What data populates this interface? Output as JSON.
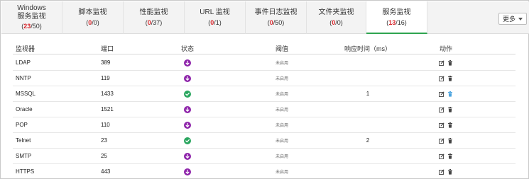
{
  "colors": {
    "tab_count_red": "#d9262b",
    "active_tab_underline": "#2ea44f",
    "status_down": "#8e24aa",
    "status_up": "#2aa65f",
    "delete_hover": "#4aa3df"
  },
  "tabs": [
    {
      "label_line1": "Windows",
      "label_line2": "服务监视",
      "count_prefix": "(",
      "count_bad": "23",
      "count_total": "/50)"
    },
    {
      "label": "脚本监视",
      "count_prefix": "(",
      "count_bad": "0",
      "count_total": "/0)"
    },
    {
      "label": "性能监视",
      "count_prefix": "(",
      "count_bad": "0",
      "count_total": "/37)"
    },
    {
      "label": "URL 监视",
      "count_prefix": "(",
      "count_bad": "0",
      "count_total": "/1)"
    },
    {
      "label": "事件日志监视",
      "count_prefix": "(",
      "count_bad": "0",
      "count_total": "/50)"
    },
    {
      "label": "文件夹监视",
      "count_prefix": "(",
      "count_bad": "0",
      "count_total": "/0)"
    },
    {
      "label": "服务监视",
      "count_prefix": "(",
      "count_bad": "13",
      "count_total": "/16)"
    }
  ],
  "more_button": {
    "label": "更多"
  },
  "table": {
    "headers": {
      "monitor": "监视器",
      "port": "端口",
      "status": "状态",
      "threshold": "阈值",
      "response": "响应时间（ms）",
      "actions": "动作"
    },
    "rows": [
      {
        "name": "LDAP",
        "port": "389",
        "status": "down",
        "threshold": "未启用",
        "response": ""
      },
      {
        "name": "NNTP",
        "port": "119",
        "status": "down",
        "threshold": "未启用",
        "response": ""
      },
      {
        "name": "MSSQL",
        "port": "1433",
        "status": "up",
        "threshold": "未启用",
        "response": "1"
      },
      {
        "name": "Oracle",
        "port": "1521",
        "status": "down",
        "threshold": "未启用",
        "response": ""
      },
      {
        "name": "POP",
        "port": "110",
        "status": "down",
        "threshold": "未启用",
        "response": ""
      },
      {
        "name": "Telnet",
        "port": "23",
        "status": "up",
        "threshold": "未启用",
        "response": "2"
      },
      {
        "name": "SMTP",
        "port": "25",
        "status": "down",
        "threshold": "未启用",
        "response": ""
      },
      {
        "name": "HTTPS",
        "port": "443",
        "status": "down",
        "threshold": "未启用",
        "response": ""
      }
    ]
  },
  "icons": {
    "status_down": "arrow-down-circle-icon",
    "status_up": "check-circle-icon",
    "edit": "edit-icon",
    "delete": "trash-icon"
  }
}
